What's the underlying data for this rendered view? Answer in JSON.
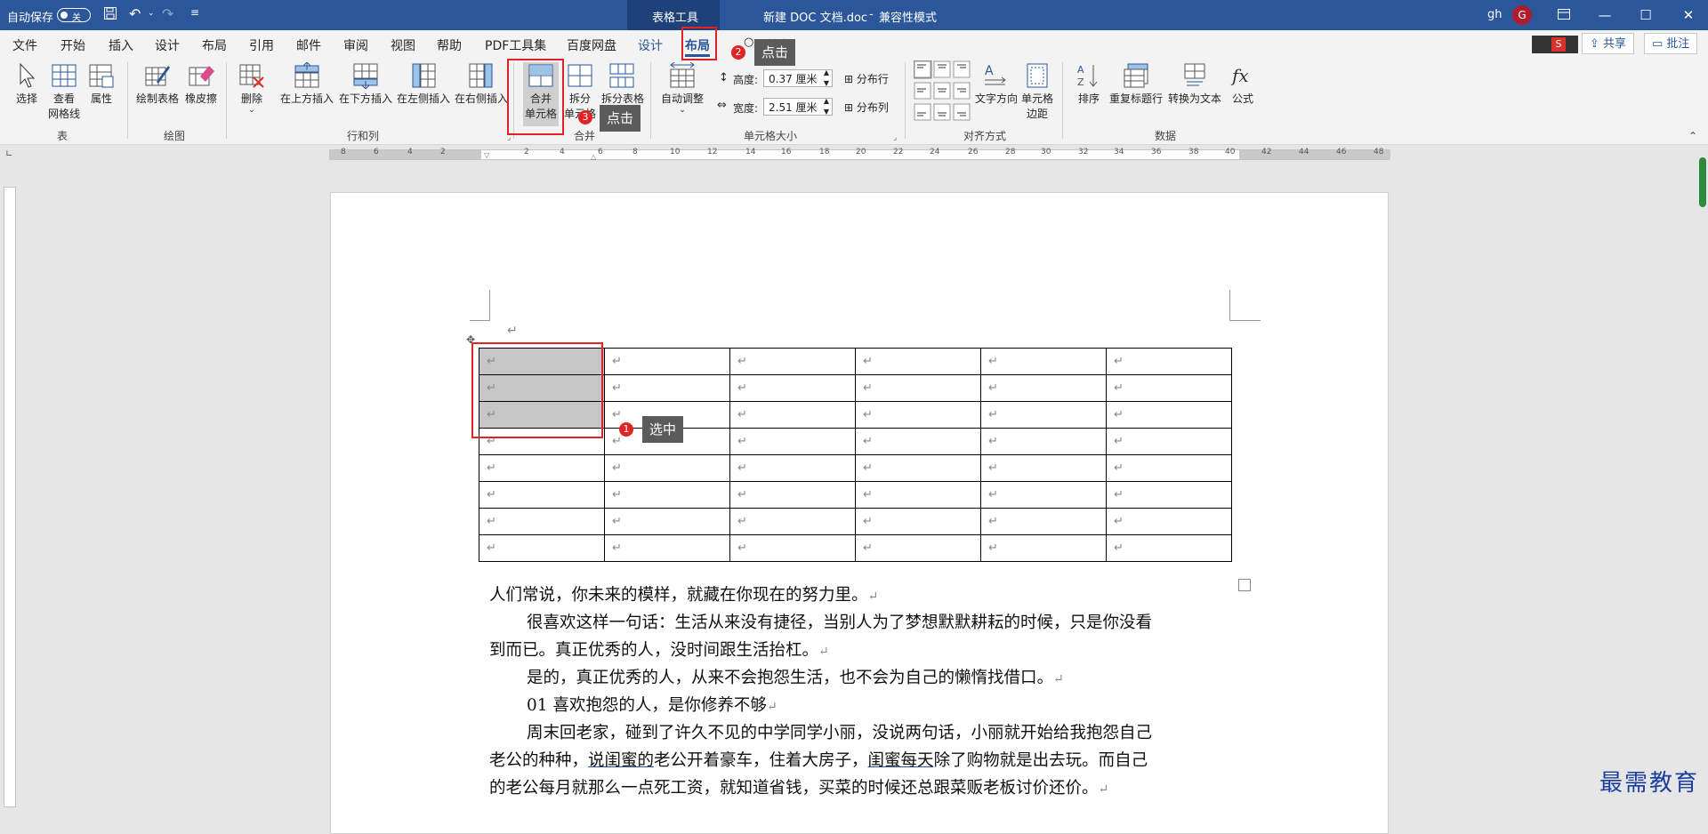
{
  "titlebar": {
    "autosave": "自动保存",
    "autosave_state": "关",
    "context_tab": "表格工具",
    "doc_title": "新建 DOC 文档.doc",
    "mode": "兼容性模式",
    "user": "gh",
    "avatar_letter": "G"
  },
  "menu": {
    "tabs": [
      "文件",
      "开始",
      "插入",
      "设计",
      "布局",
      "引用",
      "邮件",
      "审阅",
      "视图",
      "帮助",
      "PDF工具集",
      "百度网盘",
      "设计",
      "布局"
    ],
    "search": "搜索",
    "share": "共享",
    "comment": "批注"
  },
  "ribbon": {
    "select": "选择",
    "view_gridlines": [
      "查看",
      "网格线"
    ],
    "properties": "属性",
    "draw_table": "绘制表格",
    "eraser": "橡皮擦",
    "delete": "删除",
    "insert_above": "在上方插入",
    "insert_below": "在下方插入",
    "insert_left": "在左侧插入",
    "insert_right": "在右侧插入",
    "merge_cells": [
      "合并",
      "单元格"
    ],
    "split_cells": [
      "拆分",
      "单元格"
    ],
    "split_table": "拆分表格",
    "autofit": "自动调整",
    "height_label": "高度:",
    "height_value": "0.37 厘米",
    "width_label": "宽度:",
    "width_value": "2.51 厘米",
    "distribute_rows": "分布行",
    "distribute_cols": "分布列",
    "text_direction": "文字方向",
    "cell_margins": [
      "单元格",
      "边距"
    ],
    "sort": "排序",
    "repeat_header": "重复标题行",
    "convert_text": "转换为文本",
    "formula": "公式",
    "groups": [
      "表",
      "绘图",
      "行和列",
      "合并",
      "单元格大小",
      "对齐方式",
      "数据"
    ]
  },
  "ruler_numbers": [
    "8",
    "6",
    "4",
    "2",
    "2",
    "4",
    "6",
    "8",
    "10",
    "12",
    "14",
    "16",
    "18",
    "20",
    "22",
    "24",
    "26",
    "28",
    "30",
    "32",
    "34",
    "36",
    "38",
    "40",
    "42",
    "44",
    "46",
    "48"
  ],
  "table": {
    "rows": 8,
    "cols": 6,
    "mark": "↵"
  },
  "document": {
    "p1": "人们常说，你未来的模样，就藏在你现在的努力里。",
    "p2a": "很喜欢这样一句话：生活从来没有捷径，当别人为了梦想默默耕耘的时候，只是你没看",
    "p2b": "到而已。真正优秀的人，没时间跟生活抬杠。",
    "p3": "是的，真正优秀的人，从来不会抱怨生活，也不会为自己的懒惰找借口。",
    "p4": "01  喜欢抱怨的人，是你修养不够",
    "p5a": "周末回老家，碰到了许久不见的中学同学小丽，没说两句话，小丽就开始给我抱怨自己",
    "p5b_1": "老公的种种，",
    "p5b_2": "说闺蜜的",
    "p5b_3": "老公开着豪车，住着大房子，",
    "p5b_4": "闺蜜每天",
    "p5b_5": "除了购物就是出去玩。而自己",
    "p5c": "的老公每月就那么一点死工资，就知道省钱，买菜的时候还总跟菜贩老板讨价还价。"
  },
  "annotations": {
    "step1": "1",
    "step1_text": "选中",
    "step2": "2",
    "step2_text": "点击",
    "step3": "3",
    "step3_text": "点击"
  },
  "watermark": "最需教育",
  "colors": {
    "titlebar": "#2b579a",
    "annotation": "#e02424",
    "watermark": "#1a3f9e"
  }
}
